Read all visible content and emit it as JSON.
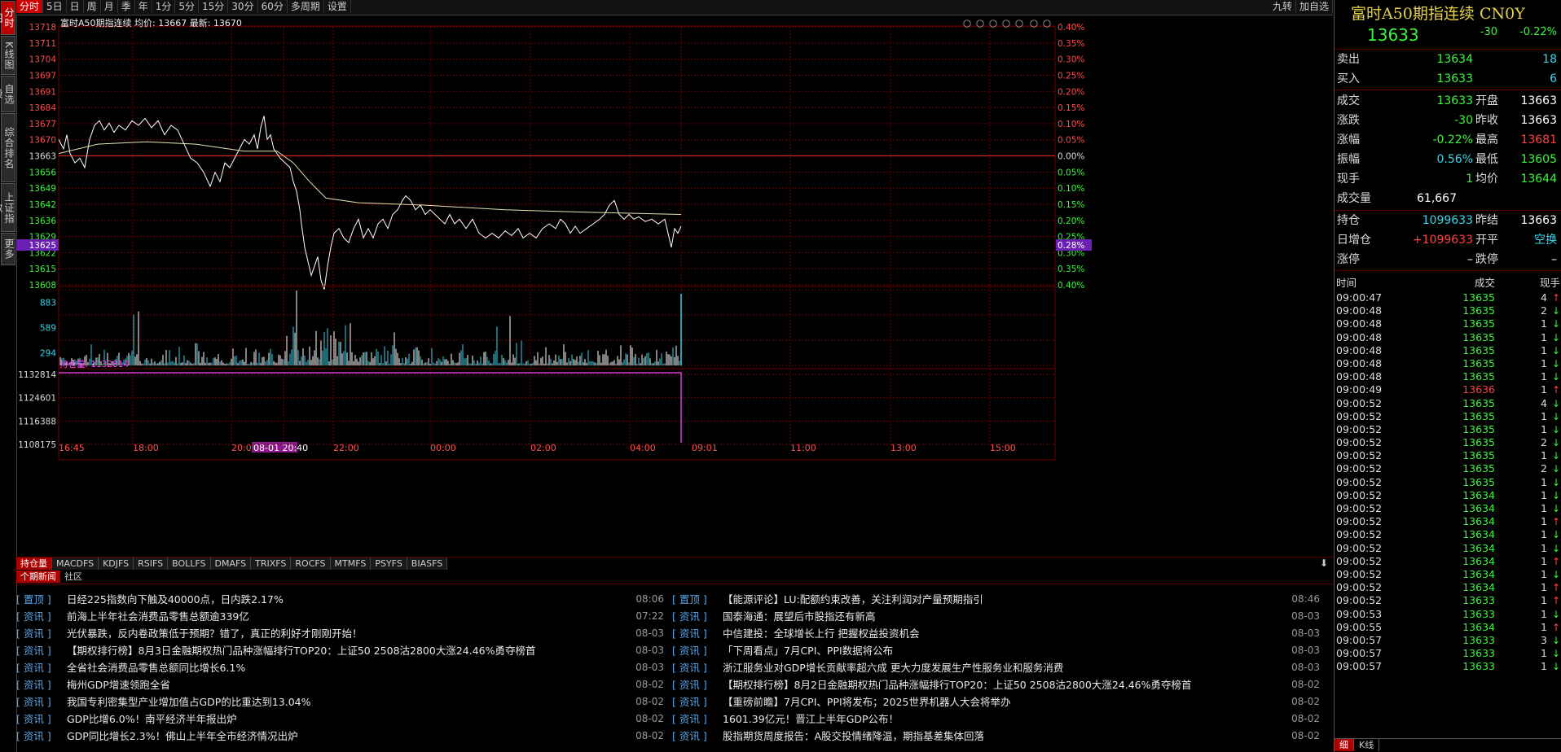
{
  "left_tabs": [
    "分时图",
    "K线图",
    "自选股",
    "综合排名",
    "上证指数",
    "更多"
  ],
  "toolbar": {
    "items": [
      "分时",
      "5日",
      "日",
      "周",
      "月",
      "季",
      "年",
      "1分",
      "5分",
      "15分",
      "30分",
      "60分",
      "多周期",
      "设置"
    ],
    "right_items": [
      "九转",
      "加自选"
    ]
  },
  "chart": {
    "header": "富时A50期指连续 均价: 13667 最新: 13670",
    "current_price_label": "13625",
    "current_pct_label": "0.28%",
    "price_ticks": [
      "13718",
      "13711",
      "13704",
      "13697",
      "13691",
      "13684",
      "13677",
      "13670",
      "13663",
      "13656",
      "13649",
      "13642",
      "13636",
      "13629",
      "13622",
      "13615",
      "13608"
    ],
    "pct_ticks": [
      "0.40%",
      "0.35%",
      "0.30%",
      "0.25%",
      "0.20%",
      "0.15%",
      "0.10%",
      "0.05%",
      "0.00%",
      "0.05%",
      "0.10%",
      "0.15%",
      "0.20%",
      "0.25%",
      "0.30%",
      "0.35%",
      "0.40%"
    ],
    "volume_ticks": [
      "883",
      "589",
      "294"
    ],
    "oi_label": "持仓量: 1132814",
    "oi_ticks": [
      "1132814",
      "1124601",
      "1116388",
      "1108175"
    ],
    "time_ticks": [
      "16:45",
      "18:00",
      "20:00",
      "08-01 20:40",
      "22:00",
      "00:00",
      "02:00",
      "04:00",
      "09:01",
      "11:00",
      "13:00",
      "15:00"
    ],
    "colors": {
      "price": "#ffffff",
      "avg": "#e8e0b0",
      "grid": "#6a0000",
      "volume": "#ffffff",
      "volume_alt": "#3ad5e8",
      "oi": "#ff44ff"
    }
  },
  "indicator_tabs": [
    "持仓量",
    "MACDFS",
    "KDJFS",
    "RSIFS",
    "BOLLFS",
    "DMAFS",
    "TRIXFS",
    "ROCFS",
    "MTMFS",
    "PSYFS",
    "BIASFS"
  ],
  "news_tabs": [
    "个期新闻",
    "社区"
  ],
  "news_left": [
    {
      "tag": "[ 置顶 ]",
      "title": "日经225指数向下触及40000点，日内跌2.17%",
      "time": "08:06"
    },
    {
      "tag": "[ 资讯 ]",
      "title": "前海上半年社会消费品零售总额逾339亿",
      "time": "07:22"
    },
    {
      "tag": "[ 资讯 ]",
      "title": "光伏暴跌，反内卷政策低于预期？错了，真正的利好才刚刚开始！",
      "time": "08-03"
    },
    {
      "tag": "[ 资讯 ]",
      "title": "【期权排行榜】8月3日金融期权热门品种涨幅排行TOP20：上证50 2508沽2800大涨24.46%勇夺榜首",
      "time": "08-03"
    },
    {
      "tag": "[ 资讯 ]",
      "title": "全省社会消费品零售总额同比增长6.1%",
      "time": "08-03"
    },
    {
      "tag": "[ 资讯 ]",
      "title": "梅州GDP增速领跑全省",
      "time": "08-02"
    },
    {
      "tag": "[ 资讯 ]",
      "title": "我国专利密集型产业增加值占GDP的比重达到13.04%",
      "time": "08-02"
    },
    {
      "tag": "[ 资讯 ]",
      "title": "GDP比增6.0%！南平经济半年报出炉",
      "time": "08-02"
    },
    {
      "tag": "[ 资讯 ]",
      "title": "GDP同比增长2.3%！佛山上半年全市经济情况出炉",
      "time": "08-02"
    }
  ],
  "news_right": [
    {
      "tag": "[ 置顶 ]",
      "title": "【能源评论】LU:配额约束改善，关注利润对产量预期指引",
      "time": "08:46"
    },
    {
      "tag": "[ 资讯 ]",
      "title": "国泰海通：展望后市股指还有新高",
      "time": "08-03"
    },
    {
      "tag": "[ 资讯 ]",
      "title": "中信建投：全球增长上行 把握权益投资机会",
      "time": "08-03"
    },
    {
      "tag": "[ 资讯 ]",
      "title": "「下周看点」7月CPI、PPI数据将公布",
      "time": "08-03"
    },
    {
      "tag": "[ 资讯 ]",
      "title": "浙江服务业对GDP增长贡献率超六成 更大力度发展生产性服务业和服务消费",
      "time": "08-03"
    },
    {
      "tag": "[ 资讯 ]",
      "title": "【期权排行榜】8月2日金融期权热门品种涨幅排行TOP20：上证50 2508沽2800大涨24.46%勇夺榜首",
      "time": "08-02"
    },
    {
      "tag": "[ 资讯 ]",
      "title": "【重磅前瞻】7月CPI、PPI将发布；2025世界机器人大会将举办",
      "time": "08-02"
    },
    {
      "tag": "[ 资讯 ]",
      "title": "1601.39亿元！晋江上半年GDP公布！",
      "time": "08-02"
    },
    {
      "tag": "[ 资讯 ]",
      "title": "股指期货周度报告：A股交投情绪降温，期指基差集体回落",
      "time": "08-02"
    }
  ],
  "quote": {
    "title": "富时A50期指连续 CN0Y",
    "last": "13633",
    "change": "-30",
    "pct": "-0.22%",
    "sell_label": "卖出",
    "sell_price": "13634",
    "sell_vol": "18",
    "buy_label": "买入",
    "buy_price": "13633",
    "buy_vol": "6",
    "rows": [
      {
        "l1": "成交",
        "v1": "13633",
        "l2": "开盘",
        "v2": "13663"
      },
      {
        "l1": "涨跌",
        "v1": "-30",
        "l2": "昨收",
        "v2": "13663"
      },
      {
        "l1": "涨幅",
        "v1": "-0.22%",
        "l2": "最高",
        "v2": "13681"
      },
      {
        "l1": "振幅",
        "v1": "0.56%",
        "l2": "最低",
        "v2": "13605"
      },
      {
        "l1": "现手",
        "v1": "1",
        "l2": "均价",
        "v2": "13644"
      }
    ],
    "volume_label": "成交量",
    "volume": "61,667",
    "oi_rows": [
      {
        "l1": "持仓",
        "v1": "1099633",
        "l2": "昨结",
        "v2": "13663"
      },
      {
        "l1": "日增仓",
        "v1": "+1099633",
        "l2": "开平",
        "v2": "空换"
      },
      {
        "l1": "涨停",
        "v1": "–",
        "l2": "跌停",
        "v2": "–"
      }
    ],
    "tick_headers": [
      "时间",
      "成交",
      "现手"
    ],
    "ticks": [
      [
        "09:00:47",
        "13635",
        "4",
        "up"
      ],
      [
        "09:00:48",
        "13635",
        "2",
        "down"
      ],
      [
        "09:00:48",
        "13635",
        "1",
        "down"
      ],
      [
        "09:00:48",
        "13635",
        "1",
        "down"
      ],
      [
        "09:00:48",
        "13635",
        "1",
        "down"
      ],
      [
        "09:00:48",
        "13635",
        "1",
        "down"
      ],
      [
        "09:00:48",
        "13635",
        "1",
        "down"
      ],
      [
        "09:00:49",
        "13636",
        "1",
        "up"
      ],
      [
        "09:00:52",
        "13635",
        "4",
        "down"
      ],
      [
        "09:00:52",
        "13635",
        "1",
        "down"
      ],
      [
        "09:00:52",
        "13635",
        "1",
        "down"
      ],
      [
        "09:00:52",
        "13635",
        "2",
        "down"
      ],
      [
        "09:00:52",
        "13635",
        "1",
        "down"
      ],
      [
        "09:00:52",
        "13635",
        "2",
        "down"
      ],
      [
        "09:00:52",
        "13635",
        "1",
        "down"
      ],
      [
        "09:00:52",
        "13634",
        "1",
        "down"
      ],
      [
        "09:00:52",
        "13634",
        "1",
        "down"
      ],
      [
        "09:00:52",
        "13634",
        "1",
        "up"
      ],
      [
        "09:00:52",
        "13634",
        "1",
        "down"
      ],
      [
        "09:00:52",
        "13634",
        "1",
        "down"
      ],
      [
        "09:00:52",
        "13634",
        "1",
        "up"
      ],
      [
        "09:00:52",
        "13634",
        "1",
        "down"
      ],
      [
        "09:00:52",
        "13634",
        "1",
        "up"
      ],
      [
        "09:00:52",
        "13633",
        "1",
        "up"
      ],
      [
        "09:00:53",
        "13633",
        "1",
        "down"
      ],
      [
        "09:00:55",
        "13634",
        "1",
        "up"
      ],
      [
        "09:00:57",
        "13633",
        "3",
        "down"
      ],
      [
        "09:00:57",
        "13633",
        "1",
        "down"
      ],
      [
        "09:00:57",
        "13633",
        "1",
        "down"
      ]
    ],
    "bottom_tabs": [
      "细",
      "K线"
    ]
  }
}
